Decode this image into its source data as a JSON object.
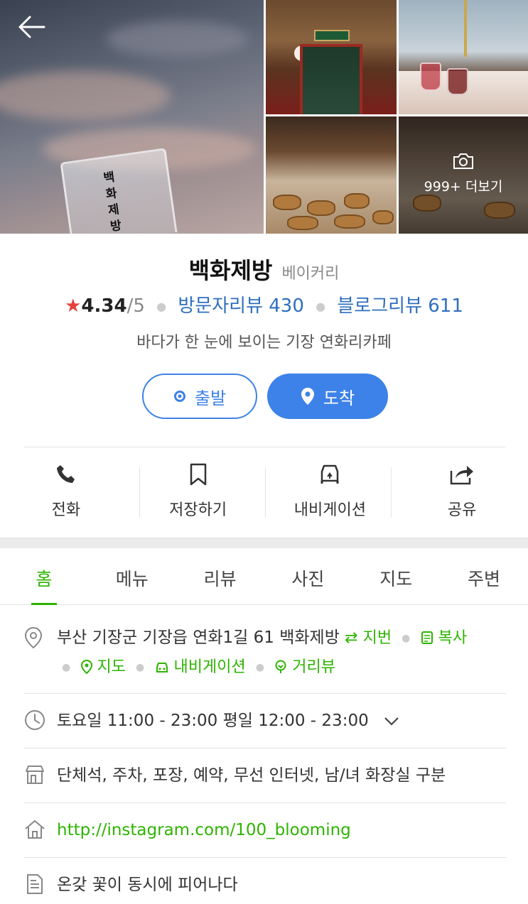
{
  "photos": {
    "more_label": "999+ 더보기",
    "main_glass_text": "백화제방"
  },
  "place": {
    "name": "백화제방",
    "category": "베이커리",
    "rating_star": "★",
    "rating": "4.34",
    "rating_max": "/5",
    "visitor_review": "방문자리뷰 430",
    "blog_review": "블로그리뷰 611",
    "description": "바다가 한 눈에 보이는 기장 연화리카페"
  },
  "route_buttons": {
    "start": "출발",
    "arrive": "도착"
  },
  "actions": [
    {
      "label": "전화",
      "icon": "phone-icon"
    },
    {
      "label": "저장하기",
      "icon": "bookmark-icon"
    },
    {
      "label": "내비게이션",
      "icon": "car-navigation-icon"
    },
    {
      "label": "공유",
      "icon": "share-icon"
    }
  ],
  "tabs": [
    "홈",
    "메뉴",
    "리뷰",
    "사진",
    "지도",
    "주변"
  ],
  "active_tab": "홈",
  "info": {
    "address": "부산 기장군 기장읍 연화1길 61 백화제방",
    "address_links": {
      "jibun": "지번",
      "copy": "복사",
      "map": "지도",
      "navi": "내비게이션",
      "street_view": "거리뷰"
    },
    "hours": "토요일 11:00 - 23:00 평일 12:00 - 23:00",
    "facilities": "단체석, 주차, 포장, 예약, 무선 인터넷, 남/녀 화장실 구분",
    "website": "http://instagram.com/100_blooming",
    "intro": "온갖 꽃이 동시에 피어나다"
  },
  "colors": {
    "accent_green": "#2db400",
    "button_blue": "#3d82e8",
    "link_blue": "#2f6fbf",
    "star_red": "#e5423c"
  }
}
